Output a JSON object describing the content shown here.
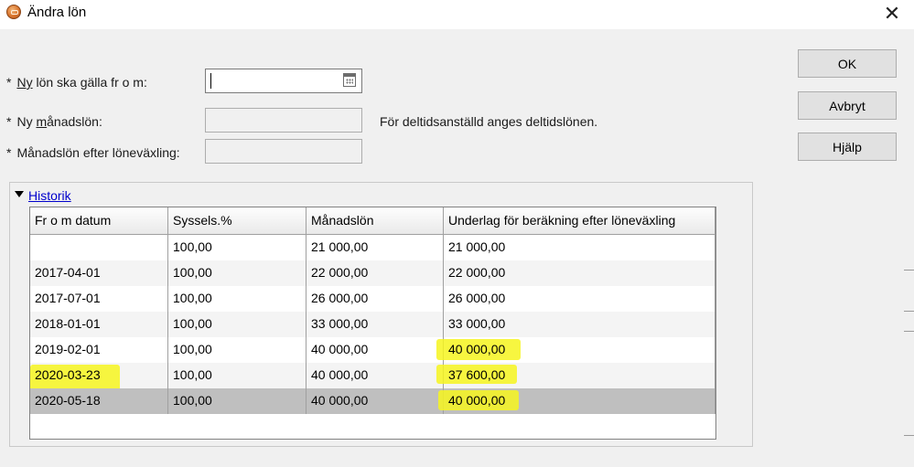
{
  "window": {
    "title": "Ändra lön",
    "close_glyph": "✕"
  },
  "form": {
    "start_date": {
      "label_prefix": "Ny",
      "label_rest": " lön ska gälla fr o m:",
      "value": ""
    },
    "monthly_salary": {
      "label_pre": "Ny ",
      "label_underlined": "m",
      "label_rest": "ånadslön:",
      "value": ""
    },
    "after_exchange": {
      "label": "Månadslön efter löneväxling:",
      "value": ""
    },
    "required_marker": "*",
    "part_time_hint": "För deltidsanställd anges deltidslönen."
  },
  "buttons": {
    "ok": "OK",
    "cancel": "Avbryt",
    "help": "Hjälp"
  },
  "history": {
    "title": "Historik",
    "columns": [
      "Fr o m datum",
      "Syssels.%",
      "Månadslön",
      "Underlag för beräkning efter löneväxling"
    ],
    "rows": [
      [
        "",
        "100,00",
        "21 000,00",
        "21 000,00"
      ],
      [
        "2017-04-01",
        "100,00",
        "22 000,00",
        "22 000,00"
      ],
      [
        "2017-07-01",
        "100,00",
        "26 000,00",
        "26 000,00"
      ],
      [
        "2018-01-01",
        "100,00",
        "33 000,00",
        "33 000,00"
      ],
      [
        "2019-02-01",
        "100,00",
        "40 000,00",
        "40 000,00"
      ],
      [
        "2020-03-23",
        "100,00",
        "40 000,00",
        "37 600,00"
      ],
      [
        "2020-05-18",
        "100,00",
        "40 000,00",
        "40 000,00"
      ]
    ],
    "selected_row": 6
  },
  "colors": {
    "highlight": "#f6f41f",
    "link": "#0000cc",
    "selected_row": "#bfbfbf"
  }
}
